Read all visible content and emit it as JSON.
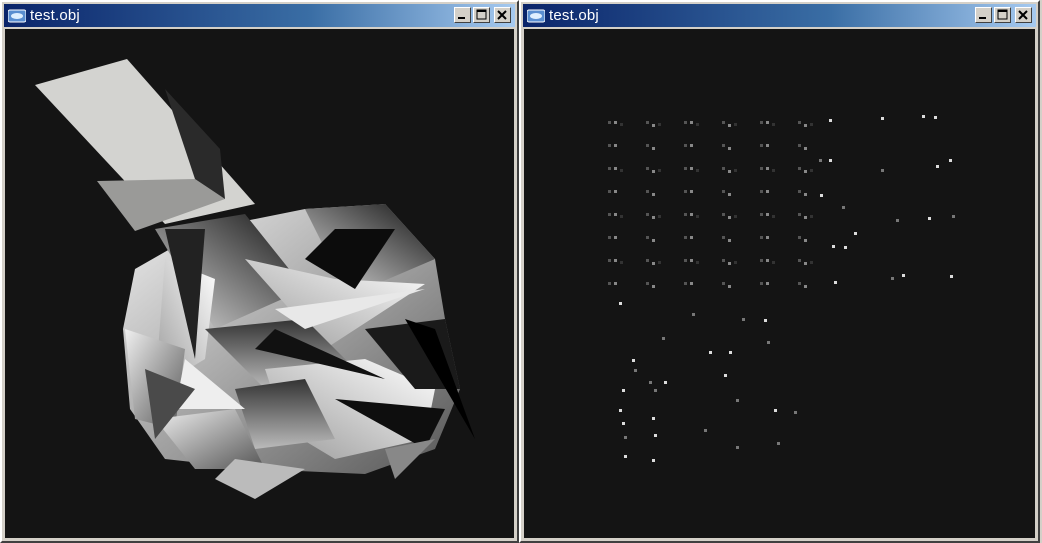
{
  "windows": [
    {
      "title": "test.obj",
      "controls": {
        "minimize": "minimize-icon",
        "maximize": "maximize-icon",
        "close": "close-icon"
      },
      "view": "shaded-mesh"
    },
    {
      "title": "test.obj",
      "controls": {
        "minimize": "minimize-icon",
        "maximize": "maximize-icon",
        "close": "close-icon"
      },
      "view": "point-cloud"
    }
  ],
  "colors": {
    "titlebar_start": "#0a246a",
    "titlebar_end": "#a6caf0",
    "viewport_bg": "#141414",
    "chrome": "#d4d0c8"
  }
}
